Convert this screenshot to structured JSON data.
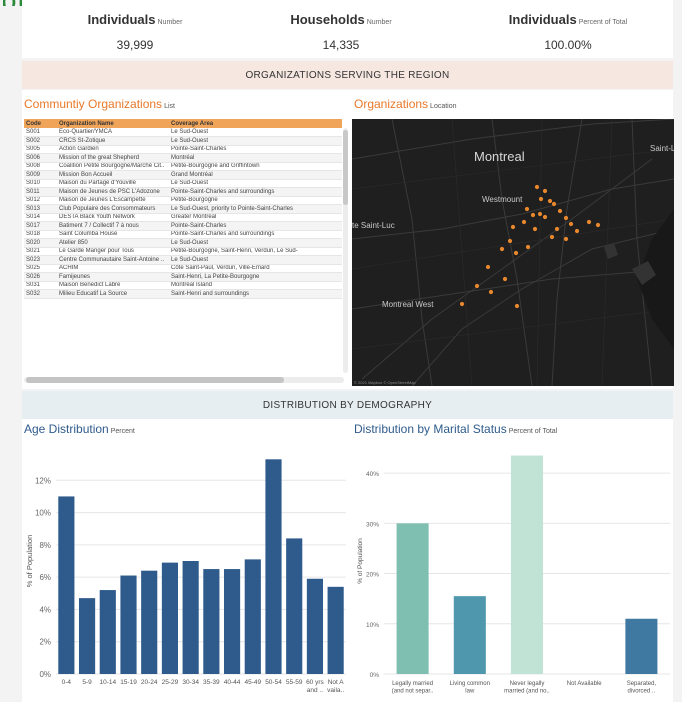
{
  "kpis": [
    {
      "label": "Individuals",
      "sub": "Number",
      "value": "39,999"
    },
    {
      "label": "Households",
      "sub": "Number",
      "value": "14,335"
    },
    {
      "label": "Individuals",
      "sub": "Percent of Total",
      "value": "100.00%"
    }
  ],
  "sections": {
    "organizations": "ORGANIZATIONS SERVING THE REGION",
    "demography": "DISTRIBUTION BY DEMOGRAPHY"
  },
  "community": {
    "title": "Communtiy Organizations",
    "sub": "List",
    "headers": [
      "Code",
      "Organization Name",
      "Coverage Area"
    ],
    "rows": [
      [
        "S001",
        "Eco-Quartier/YMCA",
        "Le Sud-Ouest"
      ],
      [
        "S002",
        "CRCS St-Zotique",
        "Le Sud-Ouest"
      ],
      [
        "S005",
        "Action Gardien",
        "Pointe-Saint-Charles"
      ],
      [
        "S006",
        "Mission of the great Shepherd",
        "Montréal"
      ],
      [
        "S008",
        "Coalition Petite Bourgogne/Marché Cit..",
        "Petite-Bourgogne and Griffintown"
      ],
      [
        "S009",
        "Mission Bon Accueil",
        "Grand Montréal"
      ],
      [
        "S010",
        "Maison du Partage d'Youville",
        "Le Sud-Ouest"
      ],
      [
        "S011",
        "Maison de Jeunes de PSC L'Adozone",
        "Pointe-Saint-Charles and surroundings"
      ],
      [
        "S012",
        "Maison de Jeunes L'Escampette",
        "Petite-Bourgogne"
      ],
      [
        "S013",
        "Club Populaire des Consommateurs",
        "Le Sud-Ouest, priority to Pointe-Saint-Charles"
      ],
      [
        "S014",
        "DESTA Black Youth Network",
        "Greater Montréal"
      ],
      [
        "S017",
        "Batiment 7 / Collectif 7 à nous",
        "Pointe-Saint-Charles"
      ],
      [
        "S018",
        "Saint Columba House",
        "Pointe-Saint-Charles and surroundings"
      ],
      [
        "S020",
        "Atelier 850",
        "Le Sud-Ouest"
      ],
      [
        "S021",
        "Le Garde Manger pour Tous",
        "Petite-Bourgogne, Saint-Henri, Verdun, Le Sud-"
      ],
      [
        "S023",
        "Centre Communautaire Saint-Antoine ..",
        "Le Sud-Ouest"
      ],
      [
        "S025",
        "ACHIM",
        "Côte Saint-Paul, Verdun, Ville-Émard"
      ],
      [
        "S026",
        "Famijeunes",
        "Saint-Henri, La Petite-Bourgogne"
      ],
      [
        "S031",
        "Maison Benedict Labre",
        "Montréal Island"
      ],
      [
        "S032",
        "Milieu Educatif La Source",
        "Saint-Henri and surroundings"
      ]
    ]
  },
  "map": {
    "title": "Organizations",
    "sub": "Location",
    "places": [
      "Montreal",
      "Westmount",
      "te Saint-Luc",
      "Montreal West",
      "Saint-La"
    ],
    "copyright": "© 2021 Mapbox © OpenStreetMap",
    "dot_color": "#e8872e"
  },
  "age_chart": {
    "title": "Age Distribution",
    "sub": "Percent",
    "chart_data": {
      "type": "bar",
      "ylabel": "% of Population",
      "ylim": [
        0,
        14
      ],
      "yticks": [
        0,
        2,
        4,
        6,
        8,
        10,
        12
      ],
      "ytick_labels": [
        "0%",
        "2%",
        "4%",
        "6%",
        "8%",
        "10%",
        "12%"
      ],
      "categories": [
        "0-4",
        "5-9",
        "10-14",
        "15-19",
        "20-24",
        "25-29",
        "30-34",
        "35-39",
        "40-44",
        "45-49",
        "50-54",
        "55-59",
        "60 yrs and ..",
        "Not A vaila.."
      ],
      "values": [
        11.0,
        4.7,
        5.2,
        6.1,
        6.4,
        6.9,
        7.0,
        6.5,
        6.5,
        7.1,
        13.3,
        8.4,
        5.9,
        5.4
      ],
      "color": "#2f5b8c",
      "grid": true
    }
  },
  "marital_chart": {
    "title": "Distribution by Marital Status",
    "sub": "Percent of Total",
    "chart_data": {
      "type": "bar",
      "ylabel": "% of Population",
      "ylim": [
        0,
        45
      ],
      "yticks": [
        0,
        10,
        20,
        30,
        40
      ],
      "ytick_labels": [
        "0%",
        "10%",
        "20%",
        "30%",
        "40%"
      ],
      "categories": [
        [
          "Legally married",
          "(and not separ.."
        ],
        [
          "Living common",
          "law"
        ],
        [
          "Never legally",
          "married (and no.."
        ],
        [
          "Not Available"
        ],
        [
          "Separated,",
          "divorced .."
        ]
      ],
      "values": [
        30.0,
        15.5,
        43.5,
        0,
        11.0
      ],
      "colors": [
        "#7fbfb2",
        "#4f97ad",
        "#c1e3d6",
        "#c1e3d6",
        "#3f79a2"
      ],
      "grid": true
    }
  }
}
